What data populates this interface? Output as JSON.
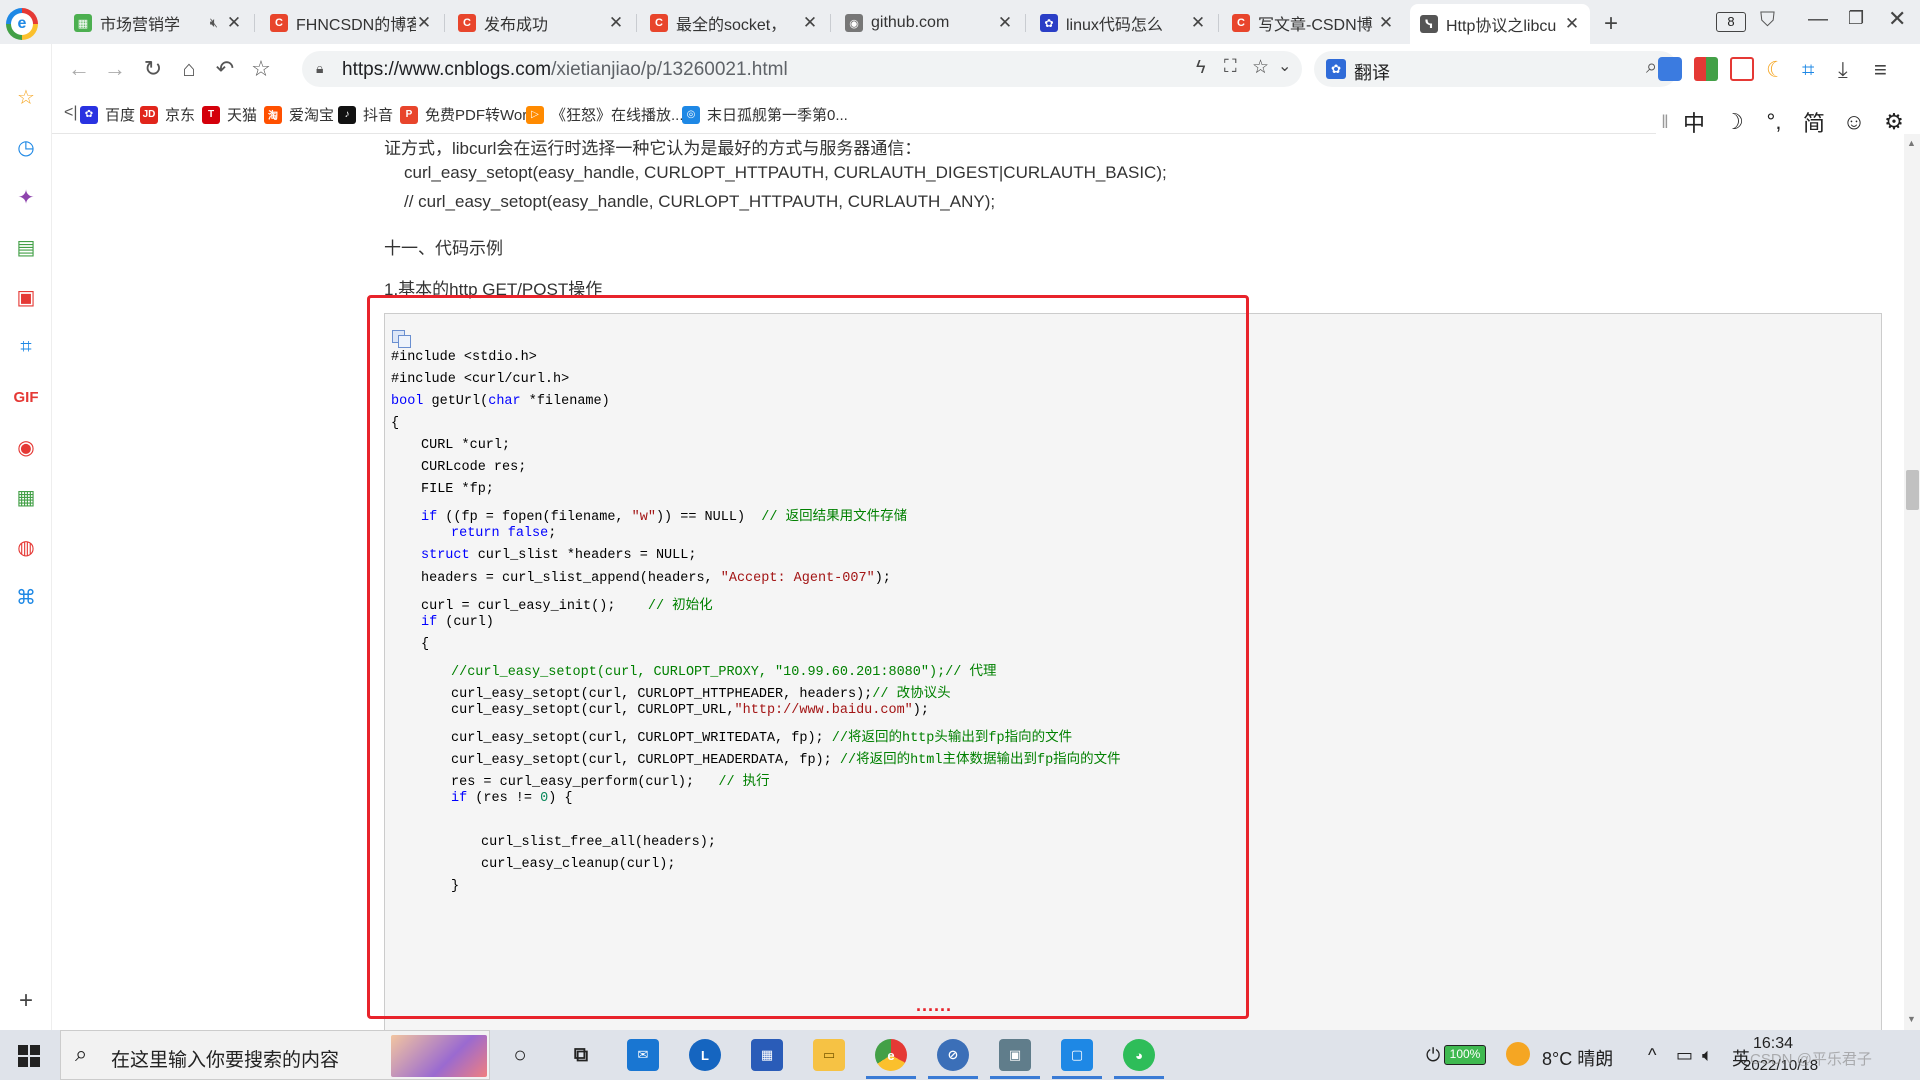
{
  "browser": {
    "tabs": [
      {
        "title": "市场营销学",
        "icon_color": "#4caf50",
        "icon_glyph": "▦",
        "muted": true
      },
      {
        "title": "FHNCSDN的博客",
        "icon_color": "#e8452c",
        "icon_glyph": "C"
      },
      {
        "title": "发布成功",
        "icon_color": "#e8452c",
        "icon_glyph": "C"
      },
      {
        "title": "最全的socket，",
        "icon_color": "#e8452c",
        "icon_glyph": "C"
      },
      {
        "title": "github.com",
        "icon_color": "#777777",
        "icon_glyph": "◉"
      },
      {
        "title": "linux代码怎么",
        "icon_color": "#2a3ec6",
        "icon_glyph": "✿"
      },
      {
        "title": "写文章-CSDN博",
        "icon_color": "#e8452c",
        "icon_glyph": "C"
      },
      {
        "title": "Http协议之libcu",
        "icon_color": "#555555",
        "icon_glyph": "ᓭ",
        "active": true
      }
    ],
    "new_tab": "+",
    "tab_count": "8",
    "url_host": "https://www.cnblogs.com",
    "url_path": "/xietianjiao/p/13260021.html",
    "search_label": "翻译",
    "bookmarks": [
      {
        "label": "百度",
        "color": "#2932e1",
        "glyph": "✿"
      },
      {
        "label": "京东",
        "color": "#e1251b",
        "glyph": "JD"
      },
      {
        "label": "天猫",
        "color": "#d4000b",
        "glyph": "T"
      },
      {
        "label": "爱淘宝",
        "color": "#ff5000",
        "glyph": "淘"
      },
      {
        "label": "抖音",
        "color": "#111111",
        "glyph": "♪"
      },
      {
        "label": "免费PDF转Word",
        "color": "#e8452c",
        "glyph": "P"
      },
      {
        "label": "《狂怒》在线播放...",
        "color": "#ff8a00",
        "glyph": "▷"
      },
      {
        "label": "末日孤舰第一季第0...",
        "color": "#1e88e5",
        "glyph": "◎"
      }
    ],
    "ime": [
      "中",
      "☽",
      "°,",
      "简",
      "☺",
      "⚙"
    ]
  },
  "article": {
    "line_auth": "证方式，libcurl会在运行时选择一种它认为是最好的方式与服务器通信：",
    "code_line_1": "curl_easy_setopt(easy_handle, CURLOPT_HTTPAUTH, CURLAUTH_DIGEST|CURLAUTH_BASIC);",
    "code_line_2": "// curl_easy_setopt(easy_handle, CURLOPT_HTTPAUTH, CURLAUTH_ANY);",
    "section_title": "十一、代码示例",
    "subsection_title": "1.基本的http GET/POST操作",
    "code": [
      {
        "indent": 0,
        "parts": [
          [
            "",
            "#include <stdio.h>"
          ]
        ]
      },
      {
        "indent": 0,
        "parts": [
          [
            "",
            "#include <curl/curl.h>"
          ]
        ]
      },
      {
        "indent": 0,
        "parts": [
          [
            "kw",
            "bool"
          ],
          [
            "",
            " getUrl("
          ],
          [
            "kw",
            "char"
          ],
          [
            "",
            " *filename)"
          ]
        ]
      },
      {
        "indent": 0,
        "parts": [
          [
            "",
            "{"
          ]
        ]
      },
      {
        "indent": 1,
        "parts": [
          [
            "",
            "CURL *curl;"
          ]
        ]
      },
      {
        "indent": 1,
        "parts": [
          [
            "",
            "CURLcode res;"
          ]
        ]
      },
      {
        "indent": 1,
        "parts": [
          [
            "",
            "FILE *fp;"
          ]
        ]
      },
      {
        "indent": 1,
        "parts": [
          [
            "kw",
            "if"
          ],
          [
            "",
            " ((fp = fopen(filename, "
          ],
          [
            "st",
            "\"w\""
          ],
          [
            "",
            ")) == NULL)  "
          ],
          [
            "cm",
            "// 返回结果用文件存储"
          ]
        ]
      },
      {
        "indent": 2,
        "parts": [
          [
            "kw",
            "return"
          ],
          [
            "",
            " "
          ],
          [
            "kw",
            "false"
          ],
          [
            "",
            ";"
          ]
        ]
      },
      {
        "indent": 1,
        "parts": [
          [
            "kw",
            "struct"
          ],
          [
            "",
            " curl_slist *headers = NULL;"
          ]
        ]
      },
      {
        "indent": 1,
        "parts": [
          [
            "",
            "headers = curl_slist_append(headers, "
          ],
          [
            "st",
            "\"Accept: Agent-007\""
          ],
          [
            "",
            ");"
          ]
        ]
      },
      {
        "indent": 1,
        "parts": [
          [
            "",
            "curl = curl_easy_init();    "
          ],
          [
            "cm",
            "// 初始化"
          ]
        ]
      },
      {
        "indent": 1,
        "parts": [
          [
            "kw",
            "if"
          ],
          [
            "",
            " (curl)"
          ]
        ]
      },
      {
        "indent": 1,
        "parts": [
          [
            "",
            "{"
          ]
        ]
      },
      {
        "indent": 2,
        "parts": [
          [
            "cm",
            "//curl_easy_setopt(curl, CURLOPT_PROXY, \"10.99.60.201:8080\");// 代理"
          ]
        ]
      },
      {
        "indent": 2,
        "parts": [
          [
            "",
            "curl_easy_setopt(curl, CURLOPT_HTTPHEADER, headers);"
          ],
          [
            "cm",
            "// 改协议头"
          ]
        ]
      },
      {
        "indent": 2,
        "parts": [
          [
            "",
            "curl_easy_setopt(curl, CURLOPT_URL,"
          ],
          [
            "st",
            "\"http://www.baidu.com\""
          ],
          [
            "",
            ");"
          ]
        ]
      },
      {
        "indent": 2,
        "parts": [
          [
            "",
            "curl_easy_setopt(curl, CURLOPT_WRITEDATA, fp); "
          ],
          [
            "cm",
            "//将返回的http头输出到fp指向的文件"
          ]
        ]
      },
      {
        "indent": 2,
        "parts": [
          [
            "",
            "curl_easy_setopt(curl, CURLOPT_HEADERDATA, fp); "
          ],
          [
            "cm",
            "//将返回的html主体数据输出到fp指向的文件"
          ]
        ]
      },
      {
        "indent": 2,
        "parts": [
          [
            "",
            "res = curl_easy_perform(curl);   "
          ],
          [
            "cm",
            "// 执行"
          ]
        ]
      },
      {
        "indent": 2,
        "parts": [
          [
            "kw",
            "if"
          ],
          [
            "",
            " (res != "
          ],
          [
            "nm",
            "0"
          ],
          [
            "",
            ") {"
          ]
        ]
      },
      {
        "indent": 0,
        "parts": [
          [
            "",
            ""
          ]
        ]
      },
      {
        "indent": 3,
        "parts": [
          [
            "",
            "curl_slist_free_all(headers);"
          ]
        ]
      },
      {
        "indent": 3,
        "parts": [
          [
            "",
            "curl_easy_cleanup(curl);"
          ]
        ]
      },
      {
        "indent": 2,
        "parts": [
          [
            "",
            "}"
          ]
        ]
      }
    ],
    "ellipsis": "......"
  },
  "taskbar": {
    "search_placeholder": "在这里输入你要搜索的内容",
    "battery": "100%",
    "weather": "8°C  晴朗",
    "ime_lang": "英",
    "time": "16:34",
    "date": "2022/10/18",
    "watermark": "CSDN @平乐君子"
  },
  "colors": {
    "highlight": "#e8232b",
    "keyword": "#0000ff",
    "comment": "#008000",
    "string": "#a31515"
  }
}
